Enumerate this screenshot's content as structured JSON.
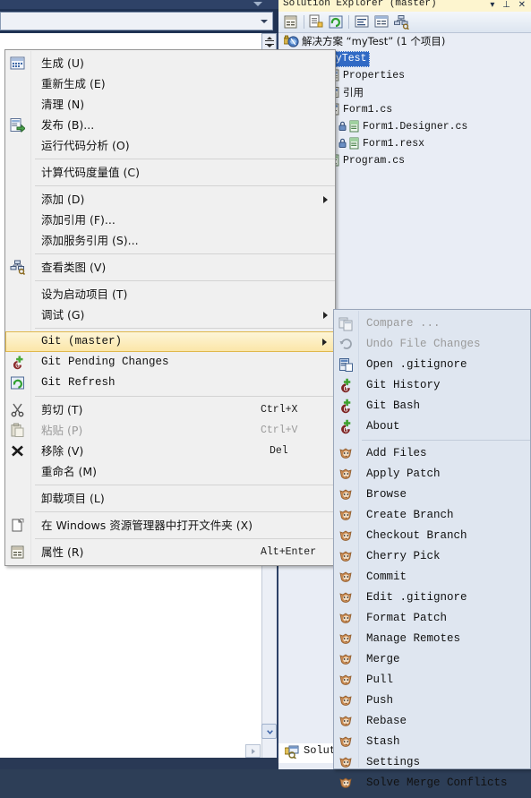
{
  "window": {
    "solution_explorer": {
      "title": "Solution Explorer (master)",
      "title_buttons": "▾  ⊥  ✕",
      "toolbar_icons": [
        {
          "name": "properties-window-icon"
        },
        {
          "name": "show-all-files-icon"
        },
        {
          "name": "refresh-icon"
        },
        {
          "name": "view-code-icon"
        },
        {
          "name": "view-designer-icon"
        },
        {
          "name": "view-class-diagram-icon"
        }
      ],
      "tree": [
        {
          "label": "解决方案 “myTest” (1 个项目)",
          "icon": "solution-icon",
          "indent": 0,
          "selected": false,
          "lang": "cn"
        },
        {
          "label": "myTest",
          "icon": "csharp-project-icon",
          "indent": 1,
          "selected": true,
          "lang": "mono"
        },
        {
          "label": "Properties",
          "icon": "properties-folder-icon",
          "indent": 2,
          "selected": false,
          "lang": "mono"
        },
        {
          "label": "引用",
          "icon": "references-icon",
          "indent": 2,
          "selected": false,
          "lang": "cn"
        },
        {
          "label": "Form1.cs",
          "icon": "form-file-icon",
          "indent": 2,
          "selected": false,
          "lang": "mono"
        },
        {
          "label": "Form1.Designer.cs",
          "icon": "cs-file-icon",
          "indent": 3,
          "selected": false,
          "lang": "mono"
        },
        {
          "label": "Form1.resx",
          "icon": "resx-file-icon",
          "indent": 3,
          "selected": false,
          "lang": "mono"
        },
        {
          "label": "Program.cs",
          "icon": "cs-file-icon",
          "indent": 2,
          "selected": false,
          "lang": "mono"
        }
      ],
      "status_label": "Solut"
    },
    "editor": {
      "combo_value": "",
      "combo_placeholder": ""
    }
  },
  "context_menu": {
    "items": [
      {
        "label": "生成 (U)",
        "icon": "build-icon",
        "accel": "",
        "arrow": false,
        "disabled": false,
        "lang": "cn"
      },
      {
        "label": "重新生成 (E)",
        "icon": "",
        "accel": "",
        "arrow": false,
        "disabled": false,
        "lang": "cn"
      },
      {
        "label": "清理 (N)",
        "icon": "",
        "accel": "",
        "arrow": false,
        "disabled": false,
        "lang": "cn"
      },
      {
        "label": "发布 (B)...",
        "icon": "publish-icon",
        "accel": "",
        "arrow": false,
        "disabled": false,
        "lang": "cn"
      },
      {
        "label": "运行代码分析 (O)",
        "icon": "",
        "accel": "",
        "arrow": false,
        "disabled": false,
        "lang": "cn"
      },
      {
        "separator": true
      },
      {
        "label": "计算代码度量值 (C)",
        "icon": "",
        "accel": "",
        "arrow": false,
        "disabled": false,
        "lang": "cn"
      },
      {
        "separator": true
      },
      {
        "label": "添加 (D)",
        "icon": "",
        "accel": "",
        "arrow": true,
        "disabled": false,
        "lang": "cn"
      },
      {
        "label": "添加引用 (F)...",
        "icon": "",
        "accel": "",
        "arrow": false,
        "disabled": false,
        "lang": "cn"
      },
      {
        "label": "添加服务引用 (S)...",
        "icon": "",
        "accel": "",
        "arrow": false,
        "disabled": false,
        "lang": "cn"
      },
      {
        "separator": true
      },
      {
        "label": "查看类图 (V)",
        "icon": "class-diagram-icon",
        "accel": "",
        "arrow": false,
        "disabled": false,
        "lang": "cn"
      },
      {
        "separator": true
      },
      {
        "label": "设为启动项目 (T)",
        "icon": "",
        "accel": "",
        "arrow": false,
        "disabled": false,
        "lang": "cn"
      },
      {
        "label": "调试 (G)",
        "icon": "",
        "accel": "",
        "arrow": true,
        "disabled": false,
        "lang": "cn"
      },
      {
        "separator": true
      },
      {
        "label": "Git (master)",
        "icon": "",
        "accel": "",
        "arrow": true,
        "disabled": false,
        "highlighted": true,
        "lang": "mono"
      },
      {
        "label": "Git Pending Changes",
        "icon": "git-extensions-icon",
        "accel": "",
        "arrow": false,
        "disabled": false,
        "lang": "mono"
      },
      {
        "label": "Git Refresh",
        "icon": "refresh-icon",
        "accel": "",
        "arrow": false,
        "disabled": false,
        "lang": "mono"
      },
      {
        "separator": true
      },
      {
        "label": "剪切 (T)",
        "icon": "cut-icon",
        "accel": "Ctrl+X",
        "arrow": false,
        "disabled": false,
        "lang": "cn"
      },
      {
        "label": "粘贴 (P)",
        "icon": "paste-icon",
        "accel": "Ctrl+V",
        "arrow": false,
        "disabled": true,
        "lang": "cn"
      },
      {
        "label": "移除 (V)",
        "icon": "remove-icon",
        "accel": "Del",
        "arrow": false,
        "disabled": false,
        "lang": "cn"
      },
      {
        "label": "重命名 (M)",
        "icon": "",
        "accel": "",
        "arrow": false,
        "disabled": false,
        "lang": "cn"
      },
      {
        "separator": true
      },
      {
        "label": "卸载项目 (L)",
        "icon": "",
        "accel": "",
        "arrow": false,
        "disabled": false,
        "lang": "cn"
      },
      {
        "separator": true
      },
      {
        "label": "在 Windows 资源管理器中打开文件夹 (X)",
        "icon": "open-folder-icon",
        "accel": "",
        "arrow": false,
        "disabled": false,
        "lang": "cn"
      },
      {
        "separator": true
      },
      {
        "label": "属性 (R)",
        "icon": "properties-icon",
        "accel": "Alt+Enter",
        "arrow": false,
        "disabled": false,
        "lang": "cn"
      }
    ]
  },
  "git_submenu": {
    "items": [
      {
        "label": "Compare ...",
        "icon": "compare-icon",
        "disabled": true
      },
      {
        "label": "Undo File Changes",
        "icon": "undo-icon",
        "disabled": true
      },
      {
        "label": "Open .gitignore",
        "icon": "open-file-icon",
        "disabled": false
      },
      {
        "label": "Git History",
        "icon": "git-extensions-icon",
        "disabled": false
      },
      {
        "label": "Git Bash",
        "icon": "git-extensions-icon",
        "disabled": false
      },
      {
        "label": "About",
        "icon": "git-extensions-icon",
        "disabled": false
      },
      {
        "separator": true
      },
      {
        "label": "Add Files",
        "icon": "git-fox-icon",
        "disabled": false
      },
      {
        "label": "Apply Patch",
        "icon": "git-fox-icon",
        "disabled": false
      },
      {
        "label": "Browse",
        "icon": "git-fox-icon",
        "disabled": false
      },
      {
        "label": "Create Branch",
        "icon": "git-fox-icon",
        "disabled": false
      },
      {
        "label": "Checkout Branch",
        "icon": "git-fox-icon",
        "disabled": false
      },
      {
        "label": "Cherry Pick",
        "icon": "git-fox-icon",
        "disabled": false
      },
      {
        "label": "Commit",
        "icon": "git-fox-icon",
        "disabled": false
      },
      {
        "label": "Edit .gitignore",
        "icon": "git-fox-icon",
        "disabled": false
      },
      {
        "label": "Format Patch",
        "icon": "git-fox-icon",
        "disabled": false
      },
      {
        "label": "Manage Remotes",
        "icon": "git-fox-icon",
        "disabled": false
      },
      {
        "label": "Merge",
        "icon": "git-fox-icon",
        "disabled": false
      },
      {
        "label": "Pull",
        "icon": "git-fox-icon",
        "disabled": false
      },
      {
        "label": "Push",
        "icon": "git-fox-icon",
        "disabled": false
      },
      {
        "label": "Rebase",
        "icon": "git-fox-icon",
        "disabled": false
      },
      {
        "label": "Stash",
        "icon": "git-fox-icon",
        "disabled": false
      },
      {
        "label": "Settings",
        "icon": "git-fox-icon",
        "disabled": false
      },
      {
        "label": "Solve Merge Conflicts",
        "icon": "git-fox-icon",
        "disabled": false
      }
    ]
  },
  "colors": {
    "menu_bg": "#f0f0f0",
    "submenu_bg": "#dfe6f0",
    "highlight": "#fbe6a8",
    "highlight_border": "#e0b84c",
    "selection_blue": "#316ac5",
    "title_yellow": "#fdf5cf",
    "shell_blue": "#2e4267"
  }
}
